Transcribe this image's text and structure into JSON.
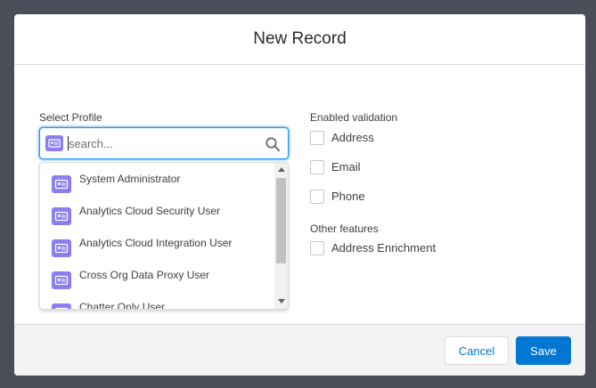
{
  "modal": {
    "title": "New Record"
  },
  "profile": {
    "label": "Select Profile",
    "search_placeholder": "search...",
    "options": [
      {
        "label": "System Administrator"
      },
      {
        "label": "Analytics Cloud Security User"
      },
      {
        "label": "Analytics Cloud Integration User"
      },
      {
        "label": "Cross Org Data Proxy User"
      },
      {
        "label": "Chatter Only User"
      }
    ]
  },
  "validation": {
    "title": "Enabled validation",
    "items": [
      {
        "label": "Address",
        "checked": false
      },
      {
        "label": "Email",
        "checked": false
      },
      {
        "label": "Phone",
        "checked": false
      }
    ]
  },
  "features": {
    "title": "Other features",
    "items": [
      {
        "label": "Address Enrichment",
        "checked": false
      }
    ]
  },
  "footer": {
    "cancel_label": "Cancel",
    "save_label": "Save"
  },
  "icons": {
    "profile_icon": "contact-card-icon",
    "search_icon": "search-icon",
    "scroll_up": "triangle-up-icon",
    "scroll_down": "triangle-down-icon"
  },
  "colors": {
    "accent": "#0176d3",
    "profile_icon_bg": "#8a7ef0",
    "backdrop": "#4a4e58",
    "focus_border": "#1b96ff"
  }
}
